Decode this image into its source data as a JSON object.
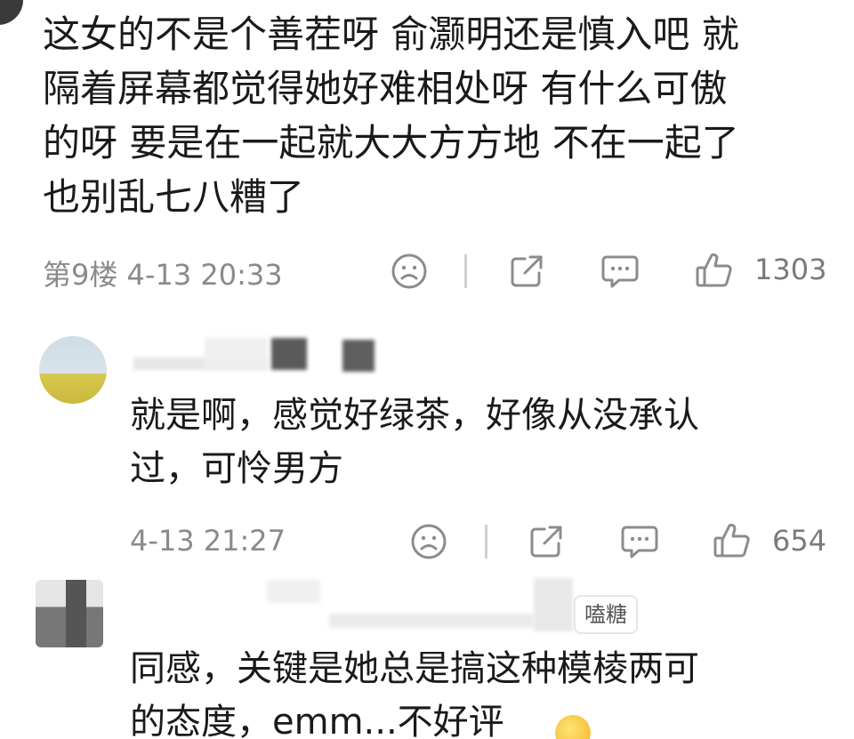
{
  "main_comment": {
    "lines": [
      "这女的不是个善茬呀 俞灏明还是慎入吧 就",
      "隔着屏幕都觉得她好难相处呀 有什么可傲",
      "的呀 要是在一起就大大方方地 不在一起了",
      "也别乱七八糟了"
    ],
    "floor": "第9楼",
    "timestamp": "4-13 20:33",
    "like_count": "1303"
  },
  "reply_1": {
    "lines": [
      "就是啊，感觉好绿茶，好像从没承认",
      "过，可怜男方"
    ],
    "timestamp": "4-13 21:27",
    "like_count": "654"
  },
  "reply_2": {
    "badge": "嗑糖",
    "lines": [
      "同感，关键是她总是搞这种模棱两可",
      "的态度，emm...不好评"
    ]
  },
  "colors": {
    "text": "#1a1a1a",
    "meta": "#8a8a8a",
    "icon": "#8c8c8c"
  },
  "icons": [
    "dislike-face-icon",
    "share-icon",
    "comment-icon",
    "thumbs-up-icon",
    "smirk-emoji-icon"
  ]
}
